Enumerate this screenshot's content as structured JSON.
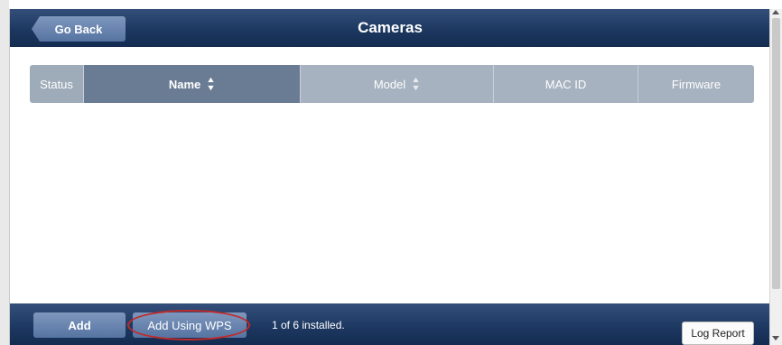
{
  "header": {
    "back_label": "Go Back",
    "title": "Cameras"
  },
  "table": {
    "columns": [
      {
        "label": "Status",
        "sortable": false
      },
      {
        "label": "Name",
        "sortable": true,
        "active": true
      },
      {
        "label": "Model",
        "sortable": true,
        "active": false
      },
      {
        "label": "MAC ID",
        "sortable": false
      },
      {
        "label": "Firmware",
        "sortable": false
      }
    ],
    "rows": []
  },
  "footer": {
    "add_label": "Add",
    "add_wps_label": "Add Using WPS",
    "install_status": "1 of 6 installed.",
    "log_report_label": "Log Report"
  },
  "icons": {
    "back": "chevron-left-icon",
    "sort": "sort-icon"
  },
  "colors": {
    "header_bar": "#1c3760",
    "button": "#5674a2",
    "active_column": "#6a7c94",
    "column": "#a6b2bf",
    "highlight_circle": "#c02a2a"
  }
}
